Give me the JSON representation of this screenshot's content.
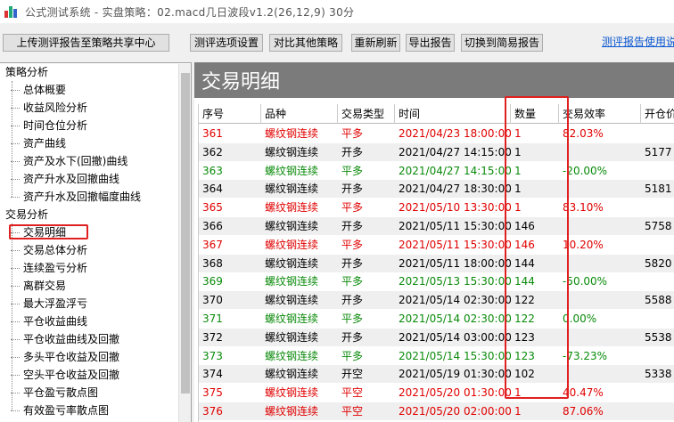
{
  "window": {
    "title": "公式测试系统 - 实盘策略：02.macd几日波段v1.2(26,12,9) 30分"
  },
  "toolbar": {
    "upload_label": "上传测评报告至策略共享中心",
    "options_label": "测评选项设置",
    "compare_label": "对比其他策略",
    "refresh_label": "重新刷新",
    "export_label": "导出报告",
    "switch_label": "切换到简易报告",
    "help_link": "测评报告使用说"
  },
  "sidebar": {
    "groups": [
      {
        "label": "策略分析",
        "items": [
          "总体概要",
          "收益风险分析",
          "时间仓位分析",
          "资产曲线",
          "资产及水下(回撤)曲线",
          "资产升水及回撤曲线",
          "资产升水及回撤幅度曲线"
        ]
      },
      {
        "label": "交易分析",
        "items": [
          "交易明细",
          "交易总体分析",
          "连续盈亏分析",
          "离群交易",
          "最大浮盈浮亏",
          "平仓收益曲线",
          "平仓收益曲线及回撤",
          "多头平仓收益及回撤",
          "空头平仓收益及回撤",
          "平仓盈亏散点图",
          "有效盈亏率散点图"
        ]
      }
    ],
    "selected": "交易明细"
  },
  "main": {
    "title": "交易明细",
    "columns": [
      "序号",
      "品种",
      "交易类型",
      "时间",
      "数量",
      "交易效率",
      "开仓价"
    ],
    "rows": [
      {
        "no": "361",
        "symbol": "螺纹钢连续",
        "type": "平多",
        "time": "2021/04/23 18:00:00",
        "qty": "1",
        "eff": "82.03%",
        "open": "",
        "color": "red"
      },
      {
        "no": "362",
        "symbol": "螺纹钢连续",
        "type": "开多",
        "time": "2021/04/27 14:15:00",
        "qty": "1",
        "eff": "",
        "open": "5177",
        "color": "black"
      },
      {
        "no": "363",
        "symbol": "螺纹钢连续",
        "type": "平多",
        "time": "2021/04/27 14:15:00",
        "qty": "1",
        "eff": "-20.00%",
        "open": "",
        "color": "green"
      },
      {
        "no": "364",
        "symbol": "螺纹钢连续",
        "type": "开多",
        "time": "2021/04/27 18:30:00",
        "qty": "1",
        "eff": "",
        "open": "5181",
        "color": "black"
      },
      {
        "no": "365",
        "symbol": "螺纹钢连续",
        "type": "平多",
        "time": "2021/05/10 13:30:00",
        "qty": "1",
        "eff": "83.10%",
        "open": "",
        "color": "red"
      },
      {
        "no": "366",
        "symbol": "螺纹钢连续",
        "type": "开多",
        "time": "2021/05/11 15:30:00",
        "qty": "146",
        "eff": "",
        "open": "5758",
        "color": "black"
      },
      {
        "no": "367",
        "symbol": "螺纹钢连续",
        "type": "平多",
        "time": "2021/05/11 15:30:00",
        "qty": "146",
        "eff": "10.20%",
        "open": "",
        "color": "red"
      },
      {
        "no": "368",
        "symbol": "螺纹钢连续",
        "type": "开多",
        "time": "2021/05/11 18:00:00",
        "qty": "144",
        "eff": "",
        "open": "5820",
        "color": "black"
      },
      {
        "no": "369",
        "symbol": "螺纹钢连续",
        "type": "平多",
        "time": "2021/05/13 15:30:00",
        "qty": "144",
        "eff": "-50.00%",
        "open": "",
        "color": "green"
      },
      {
        "no": "370",
        "symbol": "螺纹钢连续",
        "type": "开多",
        "time": "2021/05/14 02:30:00",
        "qty": "122",
        "eff": "",
        "open": "5588",
        "color": "black"
      },
      {
        "no": "371",
        "symbol": "螺纹钢连续",
        "type": "平多",
        "time": "2021/05/14 02:30:00",
        "qty": "122",
        "eff": "0.00%",
        "open": "",
        "color": "green"
      },
      {
        "no": "372",
        "symbol": "螺纹钢连续",
        "type": "开多",
        "time": "2021/05/14 03:00:00",
        "qty": "123",
        "eff": "",
        "open": "5538",
        "color": "black"
      },
      {
        "no": "373",
        "symbol": "螺纹钢连续",
        "type": "平多",
        "time": "2021/05/14 15:30:00",
        "qty": "123",
        "eff": "-73.23%",
        "open": "",
        "color": "green"
      },
      {
        "no": "374",
        "symbol": "螺纹钢连续",
        "type": "开空",
        "time": "2021/05/19 01:30:00",
        "qty": "102",
        "eff": "",
        "open": "5338",
        "color": "black"
      },
      {
        "no": "375",
        "symbol": "螺纹钢连续",
        "type": "平空",
        "time": "2021/05/20 01:30:00",
        "qty": "1",
        "eff": "40.47%",
        "open": "",
        "color": "red"
      },
      {
        "no": "376",
        "symbol": "螺纹钢连续",
        "type": "平空",
        "time": "2021/05/20 02:00:00",
        "qty": "1",
        "eff": "87.06%",
        "open": "",
        "color": "red"
      }
    ]
  }
}
